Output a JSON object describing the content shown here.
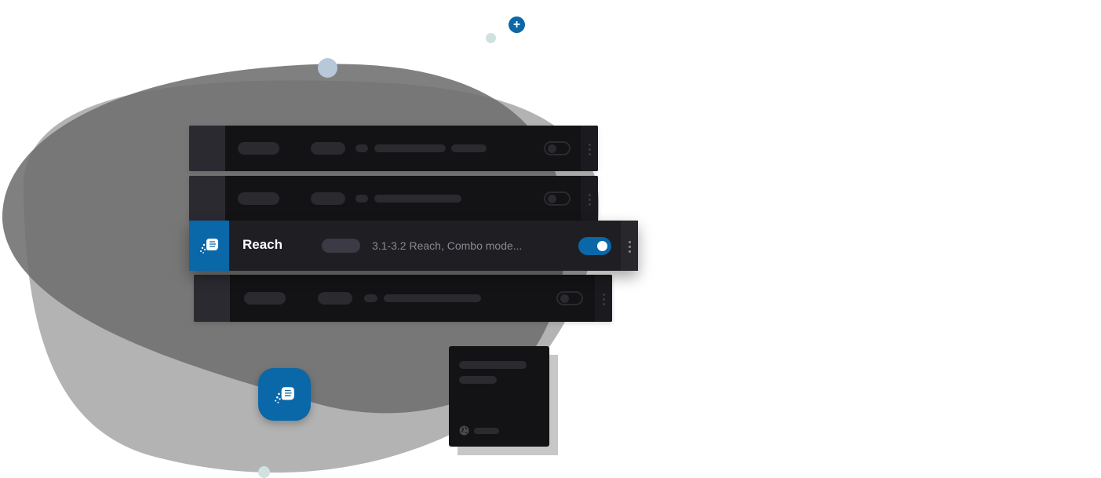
{
  "active_row": {
    "title": "Reach",
    "description": "3.1-3.2 Reach, Combo mode...",
    "toggle_on": true,
    "icon": "fist-bump-icon"
  },
  "colors": {
    "accent": "#0a67a8",
    "row_bg": "#131215",
    "active_row_bg": "#1f1e22",
    "blob_dark": "#6e6e6e",
    "blob_light": "#b3b3b3"
  },
  "icons": {
    "top_dot": "plus-icon",
    "floating": "fist-bump-icon",
    "card": "globe-icon",
    "row_menu": "kebab-icon"
  }
}
